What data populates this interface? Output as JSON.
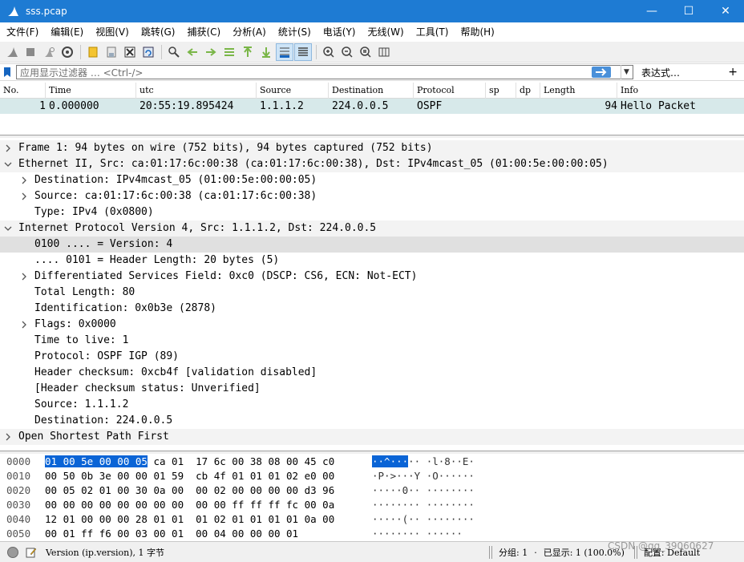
{
  "window": {
    "title": "sss.pcap",
    "minimize_glyph": "—",
    "maximize_glyph": "☐",
    "close_glyph": "✕"
  },
  "menu": [
    "文件(F)",
    "编辑(E)",
    "视图(V)",
    "跳转(G)",
    "捕获(C)",
    "分析(A)",
    "统计(S)",
    "电话(Y)",
    "无线(W)",
    "工具(T)",
    "帮助(H)"
  ],
  "filter": {
    "placeholder": "应用显示过滤器 … <Ctrl-/>",
    "expression_label": "表达式…",
    "plus": "+"
  },
  "packet_list": {
    "columns": [
      "No.",
      "Time",
      "utc",
      "Source",
      "Destination",
      "Protocol",
      "sp",
      "dp",
      "Length",
      "Info"
    ],
    "rows": [
      {
        "no": "1",
        "time": "0.000000",
        "utc": "20:55:19.895424",
        "source": "1.1.1.2",
        "destination": "224.0.0.5",
        "protocol": "OSPF",
        "sp": "",
        "dp": "",
        "length": "94",
        "info": "Hello Packet"
      }
    ]
  },
  "details": [
    {
      "text": "Frame 1: 94 bytes on wire (752 bits), 94 bytes captured (752 bits)",
      "level": 0,
      "expander": "collapsed"
    },
    {
      "text": "Ethernet II, Src: ca:01:17:6c:00:38 (ca:01:17:6c:00:38), Dst: IPv4mcast_05 (01:00:5e:00:00:05)",
      "level": 0,
      "expander": "expanded"
    },
    {
      "text": "Destination: IPv4mcast_05 (01:00:5e:00:00:05)",
      "level": 1,
      "expander": "collapsed"
    },
    {
      "text": "Source: ca:01:17:6c:00:38 (ca:01:17:6c:00:38)",
      "level": 1,
      "expander": "collapsed"
    },
    {
      "text": "Type: IPv4 (0x0800)",
      "level": 1,
      "expander": "none"
    },
    {
      "text": "Internet Protocol Version 4, Src: 1.1.1.2, Dst: 224.0.0.5",
      "level": 0,
      "expander": "expanded"
    },
    {
      "text": "0100 .... = Version: 4",
      "level": 1,
      "expander": "none",
      "selected": true
    },
    {
      "text": ".... 0101 = Header Length: 20 bytes (5)",
      "level": 1,
      "expander": "none"
    },
    {
      "text": "Differentiated Services Field: 0xc0 (DSCP: CS6, ECN: Not-ECT)",
      "level": 1,
      "expander": "collapsed"
    },
    {
      "text": "Total Length: 80",
      "level": 1,
      "expander": "none"
    },
    {
      "text": "Identification: 0x0b3e (2878)",
      "level": 1,
      "expander": "none"
    },
    {
      "text": "Flags: 0x0000",
      "level": 1,
      "expander": "collapsed"
    },
    {
      "text": "Time to live: 1",
      "level": 1,
      "expander": "none"
    },
    {
      "text": "Protocol: OSPF IGP (89)",
      "level": 1,
      "expander": "none"
    },
    {
      "text": "Header checksum: 0xcb4f [validation disabled]",
      "level": 1,
      "expander": "none"
    },
    {
      "text": "[Header checksum status: Unverified]",
      "level": 1,
      "expander": "none"
    },
    {
      "text": "Source: 1.1.1.2",
      "level": 1,
      "expander": "none"
    },
    {
      "text": "Destination: 224.0.0.5",
      "level": 1,
      "expander": "none"
    },
    {
      "text": "Open Shortest Path First",
      "level": 0,
      "expander": "collapsed"
    }
  ],
  "hex": [
    {
      "offset": "0000",
      "hl": "01 00 5e 00 00 05",
      "bytes": " ca 01  17 6c 00 38 08 00 45 c0",
      "ascii_hl": "··^···",
      "ascii": "·· ·l·8··E·"
    },
    {
      "offset": "0010",
      "hl": "",
      "bytes": "00 50 0b 3e 00 00 01 59  cb 4f 01 01 01 02 e0 00",
      "ascii_hl": "",
      "ascii": "·P·>···Y ·O······"
    },
    {
      "offset": "0020",
      "hl": "",
      "bytes": "00 05 02 01 00 30 0a 00  00 02 00 00 00 00 d3 96",
      "ascii_hl": "",
      "ascii": "·····0·· ········"
    },
    {
      "offset": "0030",
      "hl": "",
      "bytes": "00 00 00 00 00 00 00 00  00 00 ff ff ff fc 00 0a",
      "ascii_hl": "",
      "ascii": "········ ········"
    },
    {
      "offset": "0040",
      "hl": "",
      "bytes": "12 01 00 00 00 28 01 01  01 02 01 01 01 01 0a 00",
      "ascii_hl": "",
      "ascii": "·····(·· ········"
    },
    {
      "offset": "0050",
      "hl": "",
      "bytes": "00 01 ff f6 00 03 00 01  00 04 00 00 00 01",
      "ascii_hl": "",
      "ascii": "········ ······"
    }
  ],
  "status": {
    "field_info": "Version (ip.version), 1 字节",
    "groups": "分组: 1",
    "dot": "·",
    "displayed": "已显示: 1 (100.0%)",
    "profile": "配置: Default",
    "watermark": "CSDN @qq_39060627"
  }
}
